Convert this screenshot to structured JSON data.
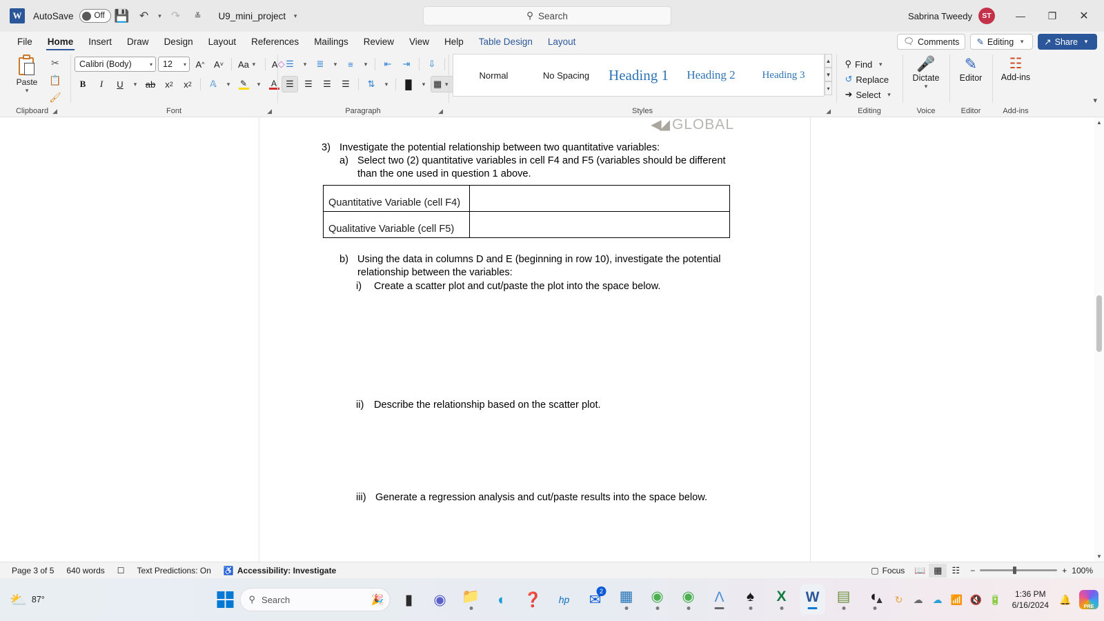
{
  "titlebar": {
    "app_icon": "word-logo",
    "autosave_label": "AutoSave",
    "autosave_state": "Off",
    "save_icon": "save-icon",
    "undo_icon": "undo-icon",
    "redo_icon": "redo-icon",
    "customize_icon": "customize-quick-access-icon",
    "document_title": "U9_mini_project",
    "title_chevron": "chevron-down-icon",
    "search_placeholder": "Search",
    "search_icon": "search-icon",
    "user_name": "Sabrina Tweedy",
    "user_initials": "ST",
    "minimize": "minimize-icon",
    "restore": "restore-icon",
    "close": "close-icon"
  },
  "tabs": [
    {
      "label": "File",
      "active": false,
      "contextual": false
    },
    {
      "label": "Home",
      "active": true,
      "contextual": false
    },
    {
      "label": "Insert",
      "active": false,
      "contextual": false
    },
    {
      "label": "Draw",
      "active": false,
      "contextual": false
    },
    {
      "label": "Design",
      "active": false,
      "contextual": false
    },
    {
      "label": "Layout",
      "active": false,
      "contextual": false
    },
    {
      "label": "References",
      "active": false,
      "contextual": false
    },
    {
      "label": "Mailings",
      "active": false,
      "contextual": false
    },
    {
      "label": "Review",
      "active": false,
      "contextual": false
    },
    {
      "label": "View",
      "active": false,
      "contextual": false
    },
    {
      "label": "Help",
      "active": false,
      "contextual": false
    },
    {
      "label": "Table Design",
      "active": false,
      "contextual": true
    },
    {
      "label": "Layout",
      "active": false,
      "contextual": true
    }
  ],
  "tab_actions": {
    "comments_label": "Comments",
    "comments_icon": "comment-icon",
    "editing_label": "Editing",
    "editing_icon": "pencil-icon",
    "editing_chevron": "chevron-down-icon",
    "share_label": "Share",
    "share_icon": "share-icon",
    "share_chevron": "chevron-down-icon"
  },
  "ribbon": {
    "clipboard": {
      "group_label": "Clipboard",
      "paste_label": "Paste",
      "paste_icon": "clipboard-icon",
      "paste_chevron": "chevron-down-icon",
      "cut_icon": "scissors-icon",
      "copy_icon": "copy-icon",
      "format_painter_icon": "format-painter-icon",
      "dialog_launcher": "dialog-launcher-icon"
    },
    "font": {
      "group_label": "Font",
      "font_name": "Calibri (Body)",
      "font_size": "12",
      "grow_font_icon": "grow-font-icon",
      "shrink_font_icon": "shrink-font-icon",
      "change_case_label": "Aa",
      "clear_formatting_icon": "clear-formatting-icon",
      "bold": "B",
      "italic": "I",
      "underline": "U",
      "strikethrough_icon": "strikethrough-icon",
      "subscript_label": "x",
      "superscript_label": "x",
      "text_effects_icon": "text-effects-icon",
      "highlight_icon": "text-highlight-icon",
      "font_color_icon": "font-color-icon",
      "dialog_launcher": "dialog-launcher-icon"
    },
    "paragraph": {
      "group_label": "Paragraph",
      "bullets_icon": "bullet-list-icon",
      "numbering_icon": "numbered-list-icon",
      "multilevel_icon": "multilevel-list-icon",
      "decrease_indent_icon": "decrease-indent-icon",
      "increase_indent_icon": "increase-indent-icon",
      "sort_icon": "sort-icon",
      "show_marks_icon": "paragraph-mark-icon",
      "align_left_icon": "align-left-icon",
      "align_center_icon": "align-center-icon",
      "align_right_icon": "align-right-icon",
      "justify_icon": "justify-icon",
      "line_spacing_icon": "line-spacing-icon",
      "shading_icon": "shading-icon",
      "borders_icon": "borders-icon",
      "dialog_launcher": "dialog-launcher-icon"
    },
    "styles": {
      "group_label": "Styles",
      "items": [
        {
          "label": "Normal"
        },
        {
          "label": "No Spacing"
        },
        {
          "label": "Heading 1"
        },
        {
          "label": "Heading 2"
        },
        {
          "label": "Heading 3"
        }
      ],
      "dialog_launcher": "dialog-launcher-icon"
    },
    "editing": {
      "group_label": "Editing",
      "find_label": "Find",
      "find_icon": "magnifier-icon",
      "find_chevron": "chevron-down-icon",
      "replace_label": "Replace",
      "replace_icon": "replace-icon",
      "select_label": "Select",
      "select_icon": "cursor-icon",
      "select_chevron": "chevron-down-icon"
    },
    "voice": {
      "group_label": "Voice",
      "dictate_label": "Dictate",
      "dictate_icon": "microphone-icon",
      "dictate_chevron": "chevron-down-icon"
    },
    "editor_group": {
      "group_label": "Editor",
      "editor_label": "Editor",
      "editor_icon": "editor-pen-icon"
    },
    "addins": {
      "group_label": "Add-ins",
      "addins_label": "Add-ins",
      "addins_icon": "addins-grid-icon"
    },
    "collapse_icon": "collapse-ribbon-icon"
  },
  "document": {
    "header_logo_text": "GLOBAL",
    "header_logo_icon": "global-swoosh-icon",
    "blocks": [
      {
        "marker": "3)",
        "text": "Investigate the potential relationship between two quantitative variables:"
      },
      {
        "marker": "a)",
        "text": "Select two (2) quantitative variables in cell F4 and F5 (variables should be different than the one used in question 1 above."
      },
      {
        "marker": "b)",
        "text": "Using the data in columns D and E (beginning in row 10), investigate the potential relationship between the variables:"
      },
      {
        "marker": "i)",
        "text": "Create a scatter plot and cut/paste the plot into the space below."
      },
      {
        "marker": "ii)",
        "text": "Describe the relationship based on the scatter plot."
      },
      {
        "marker": "iii)",
        "text": "Generate a regression analysis and cut/paste results into the space below."
      }
    ],
    "table": {
      "rows": [
        {
          "label": "Quantitative Variable (cell F4)",
          "value": ""
        },
        {
          "label": "Qualitative Variable (cell F5)",
          "value": ""
        }
      ]
    },
    "scrollbar": {
      "up_icon": "scroll-up-icon",
      "down_icon": "scroll-down-icon"
    }
  },
  "statusbar": {
    "page": "Page 3 of 5",
    "words": "640 words",
    "proofing_icon": "proofing-errors-icon",
    "text_predictions": "Text Predictions: On",
    "accessibility": "Accessibility: Investigate",
    "accessibility_icon": "accessibility-icon",
    "focus_label": "Focus",
    "focus_icon": "focus-icon",
    "read_mode_icon": "read-mode-icon",
    "print_layout_icon": "print-layout-icon",
    "web_layout_icon": "web-layout-icon",
    "zoom_out": "−",
    "zoom_in": "+",
    "zoom_level": "100%"
  },
  "taskbar": {
    "weather_temp": "87°",
    "weather_icon": "weather-cloud-sun-icon",
    "start_icon": "windows-start-icon",
    "search_placeholder": "Search",
    "search_icon": "search-icon",
    "search_decor_icon": "confetti-icon",
    "apps": [
      {
        "name": "file-explorer-dark-icon",
        "glyph": "▮",
        "color": "#2b2b2b",
        "running": false,
        "badge": ""
      },
      {
        "name": "teams-icon",
        "glyph": "◍",
        "color": "#5b5fc7",
        "running": false,
        "badge": ""
      },
      {
        "name": "file-explorer-icon",
        "glyph": "🗀",
        "color": "#e3a33a",
        "running": true,
        "badge": ""
      },
      {
        "name": "edge-icon",
        "glyph": "◓",
        "color": "#1a9bd7",
        "running": false,
        "badge": ""
      },
      {
        "name": "help-icon",
        "glyph": "?",
        "color": "#2196f3",
        "running": false,
        "badge": ""
      },
      {
        "name": "mywhp-icon",
        "glyph": "hp",
        "color": "#0b6ec4",
        "running": false,
        "badge": ""
      },
      {
        "name": "mail-icon",
        "glyph": "✉",
        "color": "#0a5ad6",
        "running": false,
        "badge": "2"
      },
      {
        "name": "store-icon",
        "glyph": "▦",
        "color": "#1f6fb5",
        "running": true,
        "badge": ""
      },
      {
        "name": "chrome-icon",
        "glyph": "◉",
        "color": "#4caf50",
        "running": true,
        "badge": ""
      },
      {
        "name": "chrome-profile-icon",
        "glyph": "◉",
        "color": "#4caf50",
        "running": true,
        "badge": ""
      },
      {
        "name": "acrobat-icon",
        "glyph": "Λ",
        "color": "#4a90d9",
        "running": true,
        "badge": ""
      },
      {
        "name": "solitaire-icon",
        "glyph": "♠",
        "color": "#1b1b1b",
        "running": true,
        "badge": ""
      },
      {
        "name": "excel-icon",
        "glyph": "X",
        "color": "#107c41",
        "running": true,
        "badge": ""
      },
      {
        "name": "word-icon",
        "glyph": "W",
        "color": "#2b579a",
        "running": true,
        "badge": ""
      },
      {
        "name": "game-icon",
        "glyph": "▤",
        "color": "#6a8f3a",
        "running": true,
        "badge": ""
      },
      {
        "name": "app-icon",
        "glyph": "◐",
        "color": "#1b1b1b",
        "running": true,
        "badge": ""
      }
    ],
    "tray": {
      "overflow_icon": "show-hidden-icons-icon",
      "update_icon": "windows-update-icon",
      "onedrive_icon": "onedrive-icon",
      "onedrive_blue_icon": "onedrive-personal-icon",
      "wifi_icon": "wifi-icon",
      "volume_icon": "volume-muted-icon",
      "battery_icon": "battery-icon",
      "time": "1:36 PM",
      "date": "6/16/2024",
      "notification_icon": "notification-bell-icon",
      "copilot_icon": "copilot-icon",
      "copilot_badge": "PRE"
    }
  }
}
